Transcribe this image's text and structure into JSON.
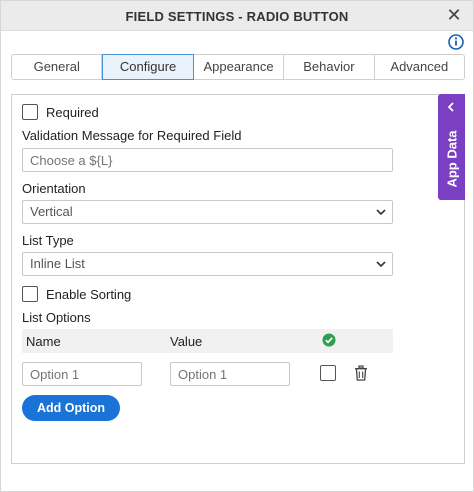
{
  "dialog": {
    "title": "FIELD SETTINGS - RADIO BUTTON",
    "close_glyph": "✕"
  },
  "tabs": [
    {
      "label": "General",
      "active": false
    },
    {
      "label": "Configure",
      "active": true
    },
    {
      "label": "Appearance",
      "active": false
    },
    {
      "label": "Behavior",
      "active": false
    },
    {
      "label": "Advanced",
      "active": false
    }
  ],
  "form": {
    "required_label": "Required",
    "validation_label": "Validation Message for Required Field",
    "validation_placeholder": "Choose a ${L}",
    "orientation_label": "Orientation",
    "orientation_value": "Vertical",
    "list_type_label": "List Type",
    "list_type_value": "Inline List",
    "enable_sorting_label": "Enable Sorting",
    "list_options_label": "List Options"
  },
  "list_options": {
    "name_header": "Name",
    "value_header": "Value",
    "rows": [
      {
        "name_placeholder": "Option 1",
        "value_placeholder": "Option 1"
      }
    ],
    "add_button_label": "Add Option"
  },
  "side_panel": {
    "label": "App Data"
  },
  "colors": {
    "accent": "#1a73d6",
    "app_data_bg": "#7b3fc4",
    "default_check": "#2e9e4f",
    "info_blue": "#1a5fb4"
  },
  "icons": {
    "close": "close-icon",
    "info": "info-icon",
    "chevron_down": "chevron-down-icon",
    "chevron_left": "chevron-left-icon",
    "check_circle": "check-circle-icon",
    "trash": "trash-icon"
  }
}
